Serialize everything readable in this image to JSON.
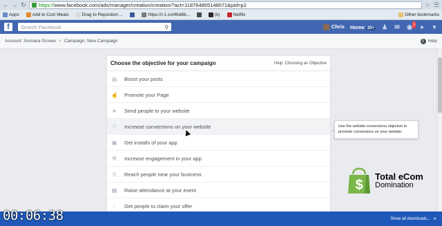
{
  "browser": {
    "url_scheme": "https://",
    "url_rest": "www.facebook.com/ads/manager/creation/creation/?act=118764855148071&pid=p2",
    "bookmarks": [
      {
        "label": "Apps",
        "color": "#6a8bc7"
      },
      {
        "label": "Add to Cozi Meals",
        "color": "#e38b2e"
      },
      {
        "label": "Drag to Repostion ...",
        "color": "#d9d9d9"
      },
      {
        "label": "",
        "color": "#3b5998"
      },
      {
        "label": "https://i-1.co/46d6b...",
        "color": "#7a7a7a"
      },
      {
        "label": "",
        "color": "#4a4a4a"
      },
      {
        "label": "(k)",
        "color": "#2a2a2a"
      },
      {
        "label": "Netflix",
        "color": "#c0272d"
      }
    ],
    "other_bookmarks": "Other bookmarks"
  },
  "facebook": {
    "logo": "f",
    "search_placeholder": "Search Facebook",
    "user_name": "Chris",
    "home_label": "Home",
    "home_count": "20+",
    "notification_count": "1"
  },
  "ads_manager": {
    "breadcrumb_account": "Account: Xiomara Groves",
    "breadcrumb_separator": ">",
    "breadcrumb_campaign": "Campaign: New Campaign",
    "help_label": "Help"
  },
  "campaign": {
    "title": "Choose the objective for your campaign",
    "help_link": "Help: Choosing an Objective",
    "objectives": [
      {
        "label": "Boost your posts",
        "icon": "posts-icon"
      },
      {
        "label": "Promote your Page",
        "icon": "thumbs-up-icon"
      },
      {
        "label": "Send people to your website",
        "icon": "cursor-icon"
      },
      {
        "label": "Increase conversions on your website",
        "icon": "globe-icon"
      },
      {
        "label": "Get installs of your app",
        "icon": "box-icon"
      },
      {
        "label": "Increase engagement in your app",
        "icon": "wrench-icon"
      },
      {
        "label": "Reach people near your business",
        "icon": "map-pin-icon"
      },
      {
        "label": "Raise attendance at your event",
        "icon": "calendar-icon"
      },
      {
        "label": "Get people to claim your offer",
        "icon": "tag-icon"
      }
    ],
    "tooltip": "Use the website conversions objective to promote conversions on your website."
  },
  "brand": {
    "line1": "Total eCom",
    "line2": "Domination",
    "color": "#7ab648"
  },
  "video": {
    "timecode": "00:06:38"
  },
  "downloads": {
    "show_all": "Show all downloads..."
  }
}
